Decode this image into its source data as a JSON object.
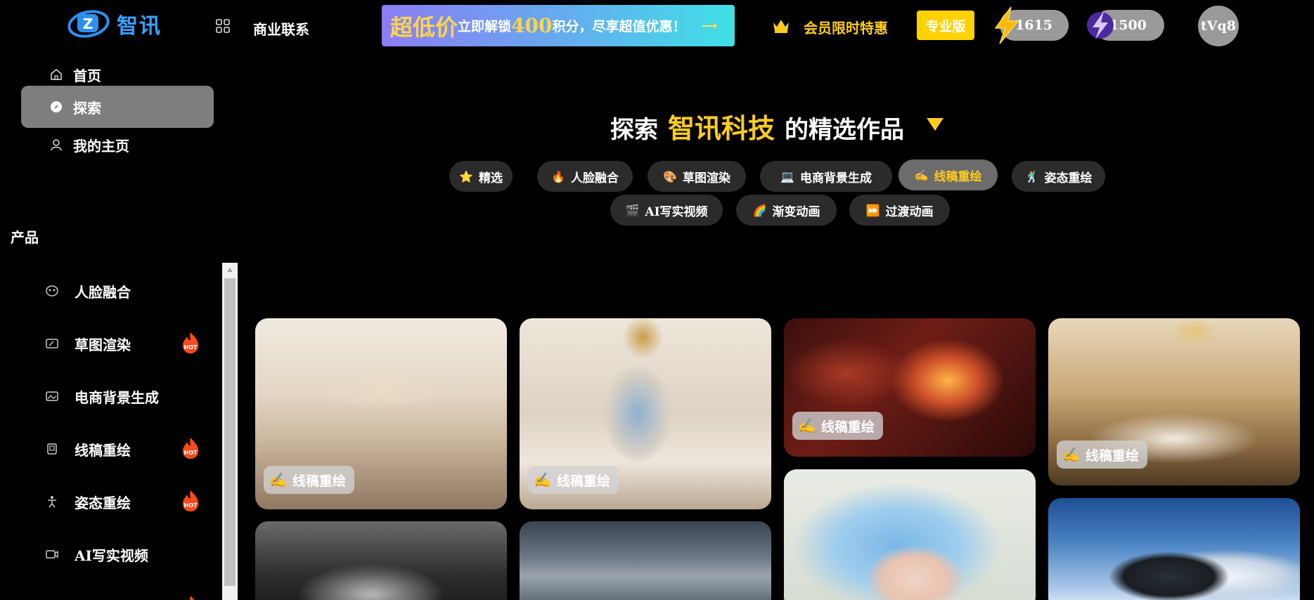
{
  "header": {
    "logo_text": "智讯",
    "business_contact": "商业联系",
    "promo": {
      "big": "超低价",
      "text1": "立即解锁",
      "num": "400",
      "text2": "积分，尽享超值优惠！",
      "arrow": "→"
    },
    "member_offer": "会员限时特惠",
    "pro_label": "专业版",
    "points_1": "1615",
    "points_2": "1500",
    "avatar_text": "tVq8"
  },
  "sidebar": {
    "nav": [
      {
        "label": "首页",
        "icon": "home-icon"
      },
      {
        "label": "探索",
        "icon": "compass-icon"
      },
      {
        "label": "我的主页",
        "icon": "user-icon"
      }
    ],
    "section_title": "产品",
    "products": [
      {
        "label": "人脸融合",
        "icon": "face-icon",
        "hot": false
      },
      {
        "label": "草图渲染",
        "icon": "sketch-icon",
        "hot": true
      },
      {
        "label": "电商背景生成",
        "icon": "image-icon",
        "hot": false
      },
      {
        "label": "线稿重绘",
        "icon": "lineart-icon",
        "hot": true
      },
      {
        "label": "姿态重绘",
        "icon": "pose-icon",
        "hot": true
      },
      {
        "label": "AI写实视频",
        "icon": "video-icon",
        "hot": false
      }
    ],
    "hot_label": "HOT"
  },
  "main": {
    "title_prefix": "探索",
    "title_brand": "智讯科技",
    "title_suffix": "的精选作品",
    "chips": [
      {
        "emoji": "⭐",
        "label": "精选"
      },
      {
        "emoji": "🔥",
        "label": "人脸融合"
      },
      {
        "emoji": "🎨",
        "label": "草图渲染"
      },
      {
        "emoji": "💻",
        "label": "电商背景生成"
      },
      {
        "emoji": "✍️",
        "label": "线稿重绘",
        "active": true
      },
      {
        "emoji": "🕺",
        "label": "姿态重绘"
      },
      {
        "emoji": "🎬",
        "label": "AI写实视频"
      },
      {
        "emoji": "🌈",
        "label": "渐变动画"
      },
      {
        "emoji": "⏩",
        "label": "过渡动画"
      }
    ],
    "card_tag": {
      "emoji": "✍️",
      "label": "线稿重绘"
    }
  },
  "colors": {
    "accent_yellow": "#ffcc22",
    "active_nav": "#7e7e7e",
    "chip_bg": "#2b2b2b",
    "chip_active_bg": "#6c6c6c"
  }
}
